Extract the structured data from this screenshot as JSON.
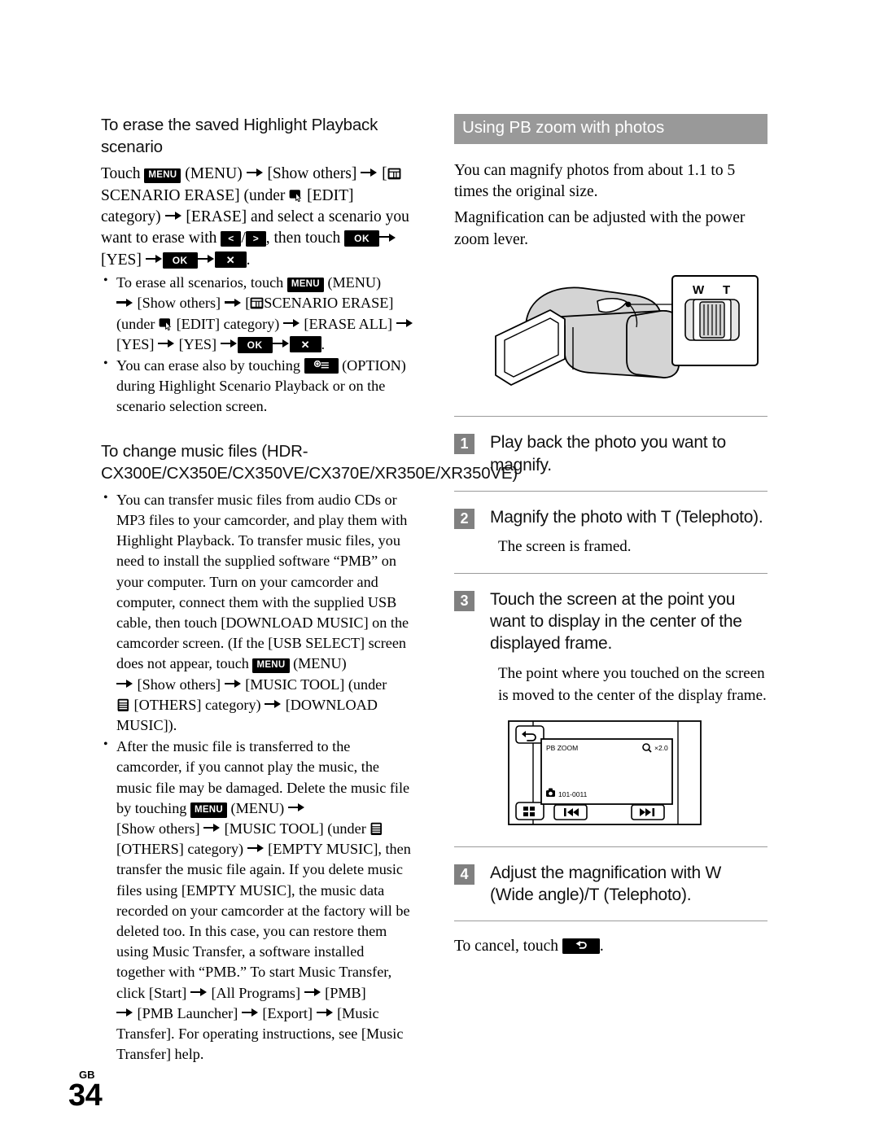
{
  "page": {
    "locale_code": "GB",
    "number": "34"
  },
  "left_column": {
    "heading_1": "To erase the saved Highlight Playback scenario",
    "para_1": {
      "t1": "Touch ",
      "menu_chip": "MENU",
      "t2": " (MENU) ",
      "t3": " [Show others] ",
      "t4": " [",
      "scenario_erase": "SCENARIO ERASE] (under ",
      "t5": " [EDIT] category) ",
      "t6": " [ERASE] and select a scenario you want to erase with ",
      "left_chip": "<",
      "right_chip": ">",
      "t7": ", then touch ",
      "ok_chip": "OK",
      "t8": " [YES] ",
      "x_chip": "✕",
      "t9": "."
    },
    "bullets": [
      {
        "b1": "To erase all scenarios, touch ",
        "menu_chip": "MENU",
        "b2": " (MENU) ",
        "b3": " [Show others] ",
        "b4": " [",
        "b5": "SCENARIO ERASE] (under ",
        "b6": " [EDIT] category) ",
        "b7": " [ERASE ALL] ",
        "b8": " [YES] ",
        "b9": " [YES] ",
        "ok_chip": "OK",
        "x_chip": "✕",
        "b10": "."
      },
      {
        "b1": "You can erase also by touching ",
        "b2": " (OPTION) during Highlight Scenario Playback or on the scenario selection screen."
      }
    ],
    "heading_2": "To change music files (HDR-CX300E/CX350E/CX350VE/CX370E/XR350E/XR350VE)",
    "bullets_2": [
      {
        "p1": "You can transfer music files from audio CDs or MP3 files to your camcorder, and play them with Highlight Playback. To transfer music files, you need to install the supplied software “PMB” on your computer. Turn on your camcorder and computer, connect them with the supplied USB cable, then touch [DOWNLOAD MUSIC] on the camcorder screen. (If the [USB SELECT] screen does not appear, touch ",
        "menu_chip": "MENU",
        "p2": " (MENU) ",
        "p3": " [Show others] ",
        "p4": " [MUSIC TOOL] (under ",
        "p5": " [OTHERS] category) ",
        "p6": " [DOWNLOAD MUSIC])."
      },
      {
        "p1": "After the music file is transferred to the camcorder, if you cannot play the music, the music file may be damaged. Delete the music file by touching ",
        "menu_chip": "MENU",
        "p2": " (MENU) ",
        "p3": " [Show others] ",
        "p4": " [MUSIC TOOL] (under ",
        "p5": " [OTHERS] category) ",
        "p6": " [EMPTY MUSIC], then transfer the music file again. If you delete music files using [EMPTY MUSIC], the music data recorded on your camcorder at the factory will be deleted too. In this case, you can restore them using Music Transfer, a software installed together with “PMB.” To start Music Transfer, click [Start] ",
        "p7": " [All Programs] ",
        "p8": " [PMB] ",
        "p9": " [PMB Launcher] ",
        "p10": " [Export] ",
        "p11": " [Music Transfer]. For operating instructions, see [Music Transfer] help."
      }
    ]
  },
  "right_column": {
    "section_title": "Using PB zoom with photos",
    "intro_line_1": "You can magnify photos from about 1.1 to 5 times the original size.",
    "intro_line_2": "Magnification can be adjusted with the power zoom lever.",
    "zoom_lever": {
      "wide_label": "W",
      "tele_label": "T"
    },
    "steps": [
      {
        "number": "1",
        "title": "Play back the photo you want to magnify.",
        "note": ""
      },
      {
        "number": "2",
        "title": "Magnify the photo with T (Telephoto).",
        "note": "The screen is framed."
      },
      {
        "number": "3",
        "title": "Touch the screen at the point you want to display in the center of the displayed frame.",
        "note": "The point where you touched on the screen is moved to the center of the display frame."
      },
      {
        "number": "4",
        "title": "Adjust the magnification with W (Wide angle)/T (Telephoto).",
        "note": ""
      }
    ],
    "pb_zoom_screen": {
      "title": "PB ZOOM",
      "magnification": "×2.0",
      "file_number": "101-0011",
      "prev_button": "⏮",
      "next_button": "⏭"
    },
    "cancel_text_before": "To cancel, touch ",
    "cancel_text_after": "."
  },
  "colors": {
    "band_gray": "#999999",
    "step_num_gray": "#808080",
    "rule_gray": "#9a9a9a",
    "illustration_fill": "#d4d4d4"
  }
}
